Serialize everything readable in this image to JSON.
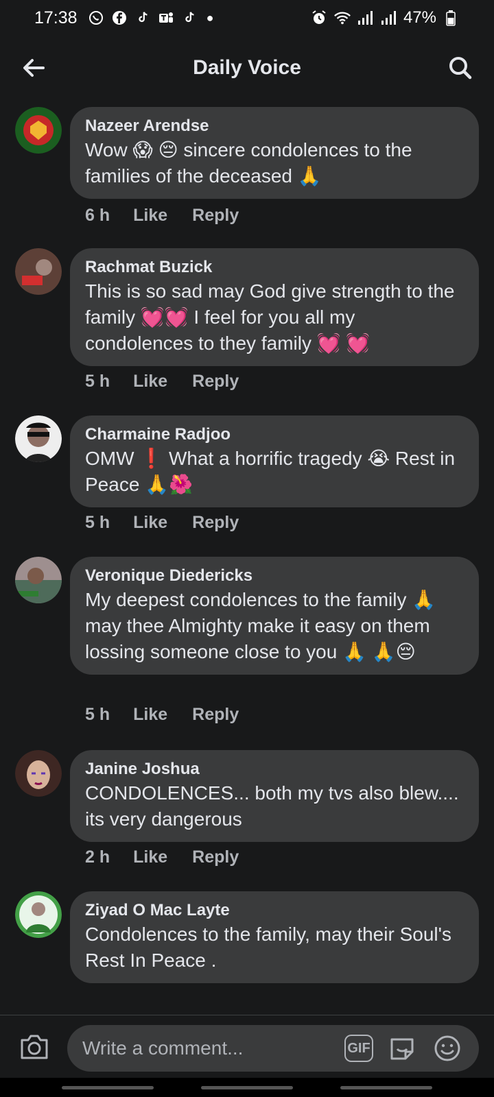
{
  "status_bar": {
    "time": "17:38",
    "battery": "47%"
  },
  "header": {
    "title": "Daily Voice"
  },
  "comments": [
    {
      "author": "Nazeer Arendse",
      "text": "Wow 😱 😔 sincere condolences to the families of the deceased 🙏",
      "time": "6 h",
      "like": "Like",
      "reply": "Reply",
      "avatar_color": "#2e7d32"
    },
    {
      "author": "Rachmat Buzick",
      "text": "This is so sad may God give strength to the family 💓💓 I feel for you all my condolences to they family 💓 💓",
      "time": "5 h",
      "like": "Like",
      "reply": "Reply",
      "avatar_color": "#8d4b3a"
    },
    {
      "author": "Charmaine Radjoo",
      "text": "OMW ❗ What a horrific tragedy 😭 Rest in Peace 🙏🌺",
      "time": "5 h",
      "like": "Like",
      "reply": "Reply",
      "avatar_color": "#222222"
    },
    {
      "author": "Veronique Diedericks",
      "text": "My deepest condolences to the family 🙏 may thee Almighty make it easy on them lossing someone close to you 🙏 🙏😔",
      "time": "5 h",
      "like": "Like",
      "reply": "Reply",
      "avatar_color": "#7a6a6a"
    },
    {
      "author": "Janine Joshua",
      "text": "CONDOLENCES... both my tvs also blew.... its very dangerous",
      "time": "2 h",
      "like": "Like",
      "reply": "Reply",
      "avatar_color": "#b08a7a"
    },
    {
      "author": "Ziyad O Mac Layte",
      "text": "Condolences to the family, may their Soul's Rest In Peace .",
      "time": "",
      "like": "",
      "reply": "",
      "avatar_color": "#2e9d4a"
    }
  ],
  "composer": {
    "placeholder": "Write a comment...",
    "gif_label": "GIF"
  }
}
